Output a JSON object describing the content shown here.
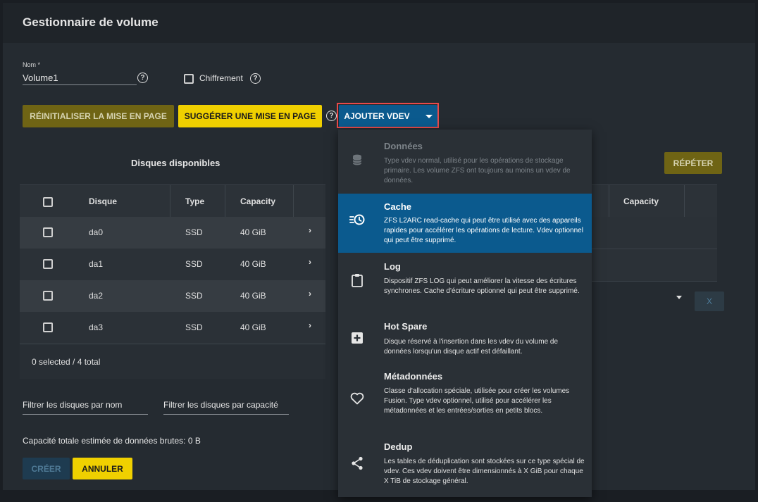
{
  "header": {
    "title": "Gestionnaire de volume"
  },
  "form": {
    "name_label": "Nom *",
    "name_value": "Volume1",
    "encryption_label": "Chiffrement"
  },
  "toolbar": {
    "reset_label": "RÉINITIALISER LA MISE EN PAGE",
    "suggest_label": "SUGGÉRER UNE MISE EN PAGE",
    "add_vdev_label": "AJOUTER VDEV",
    "repeat_label": "RÉPÉTER"
  },
  "available_disks": {
    "title": "Disques disponibles",
    "columns": [
      "Disque",
      "Type",
      "Capacity"
    ],
    "rows": [
      {
        "disk": "da0",
        "type": "SSD",
        "capacity": "40 GiB"
      },
      {
        "disk": "da1",
        "type": "SSD",
        "capacity": "40 GiB"
      },
      {
        "disk": "da2",
        "type": "SSD",
        "capacity": "40 GiB"
      },
      {
        "disk": "da3",
        "type": "SSD",
        "capacity": "40 GiB"
      }
    ],
    "footer": "0 selected / 4 total"
  },
  "right_table": {
    "capacity_header": "Capacity",
    "remove_label": "X"
  },
  "filters": {
    "by_name": "Filtrer les disques par nom",
    "by_capacity": "Filtrer les disques par capacité"
  },
  "capacity_summary": "Capacité totale estimée de données brutes: 0 B",
  "actions": {
    "create_label": "CRÉER",
    "cancel_label": "ANNULER"
  },
  "help_glyph": "?",
  "vdev_menu": [
    {
      "title": "Données",
      "description": "Type vdev normal, utilisé pour les opérations de stockage primaire. Les volume ZFS ont toujours au moins un vdev de données.",
      "icon": "database-icon",
      "state": "disabled"
    },
    {
      "title": "Cache",
      "description": "ZFS L2ARC read-cache qui peut être utilisé avec des appareils rapides pour accélérer les opérations de lecture. Vdev optionnel qui peut être supprimé.",
      "icon": "cache-clock-icon",
      "state": "active"
    },
    {
      "title": "Log",
      "description": "Dispositif ZFS LOG qui peut améliorer la vitesse des écritures synchrones. Cache d'écriture optionnel qui peut être supprimé.",
      "icon": "clipboard-icon",
      "state": "normal"
    },
    {
      "title": "Hot Spare",
      "description": "Disque réservé à l'insertion dans les vdev du volume de données lorsqu'un disque actif est défaillant.",
      "icon": "plus-box-icon",
      "state": "normal"
    },
    {
      "title": "Métadonnées",
      "description": "Classe d'allocation spéciale, utilisée pour créer les volumes Fusion. Type vdev optionnel, utilisé pour accélérer les métadonnées et les entrées/sorties en petits blocs.",
      "icon": "heart-icon",
      "state": "normal"
    },
    {
      "title": "Dedup",
      "description": "Les tables de déduplication sont stockées sur ce type spécial de vdev. Ces vdev doivent être dimensionnés à X GiB pour chaque X TiB de stockage général.",
      "icon": "share-icon",
      "state": "normal"
    }
  ],
  "colors": {
    "accent_yellow": "#f0d000",
    "accent_blue": "#0b5a8e",
    "highlight_red": "#e84a4a",
    "background": "#252b31"
  }
}
